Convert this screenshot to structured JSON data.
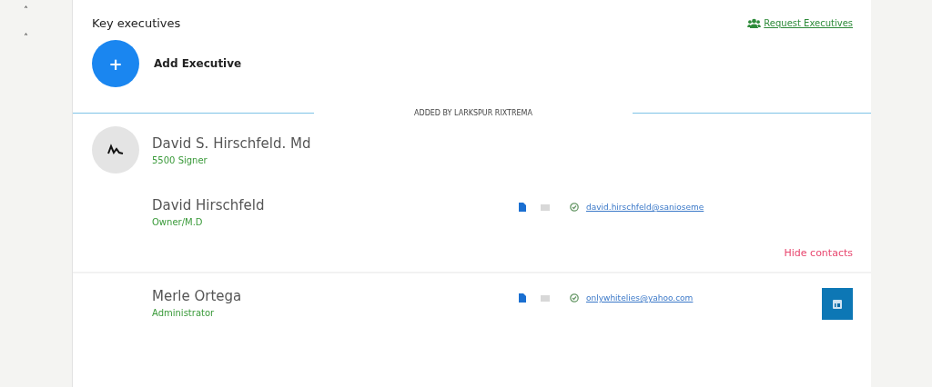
{
  "sidebar": {
    "carets": [
      "˄",
      "˄"
    ]
  },
  "title": "Key executives",
  "request_link": "Request Executives",
  "add_button": {
    "icon": "+",
    "label": "Add Executive"
  },
  "section_label": "ADDED BY LARKSPUR RIXTREMA",
  "executive": {
    "name": "David S. Hirschfeld. Md",
    "role": "5500 Signer"
  },
  "contacts": [
    {
      "name": "David Hirschfeld",
      "role": "Owner/M.D",
      "email": "david.hirschfeld@sanioseme",
      "linkedin": false,
      "footer_link": "Hide contacts"
    },
    {
      "name": "Merle Ortega",
      "role": "Administrator",
      "email": "onlywhitelies@yahoo.com",
      "linkedin": true
    }
  ]
}
